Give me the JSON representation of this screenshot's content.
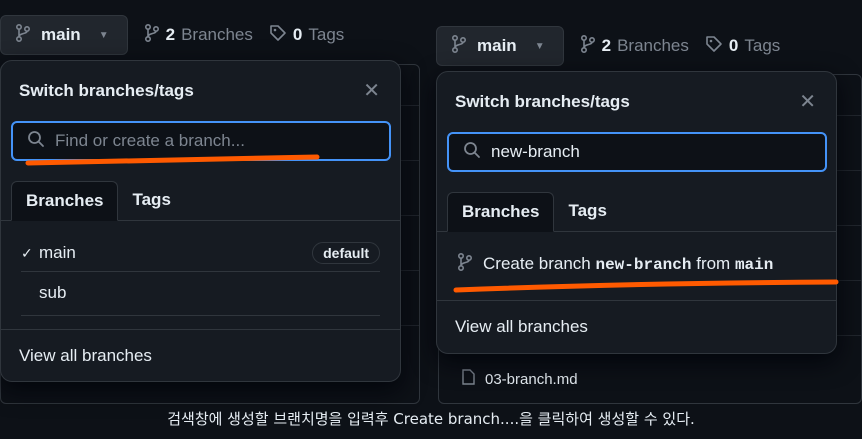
{
  "left": {
    "header": {
      "branch_button_label": "main",
      "branches_count": "2",
      "branches_label": "Branches",
      "tags_count": "0",
      "tags_label": "Tags"
    },
    "dropdown": {
      "title": "Switch branches/tags",
      "search_placeholder": "Find or create a branch...",
      "search_value": "",
      "tabs": [
        {
          "label": "Branches",
          "active": true
        },
        {
          "label": "Tags",
          "active": false
        }
      ],
      "branches": [
        {
          "name": "main",
          "checked": true,
          "badge": "default"
        },
        {
          "name": "sub",
          "checked": false,
          "badge": ""
        }
      ],
      "view_all_label": "View all branches"
    }
  },
  "right": {
    "header": {
      "branch_button_label": "main",
      "branches_count": "2",
      "branches_label": "Branches",
      "tags_count": "0",
      "tags_label": "Tags"
    },
    "dropdown": {
      "title": "Switch branches/tags",
      "search_placeholder": "Find or create a branch...",
      "search_value": "new-branch",
      "tabs": [
        {
          "label": "Branches",
          "active": true
        },
        {
          "label": "Tags",
          "active": false
        }
      ],
      "create": {
        "prefix": "Create branch",
        "new_branch": "new-branch",
        "from_word": "from",
        "source_branch": "main"
      },
      "view_all_label": "View all branches"
    },
    "background_file": "03-branch.md"
  },
  "caption": "검색창에 생성할 브랜치명을 입력후 Create branch....을 클릭하여 생성할 수 있다.",
  "colors": {
    "background": "#0d1117",
    "panel": "#161b22",
    "border": "#30363d",
    "focus": "#4493f8",
    "annotation": "#ff5a00",
    "muted": "#7d8590"
  }
}
